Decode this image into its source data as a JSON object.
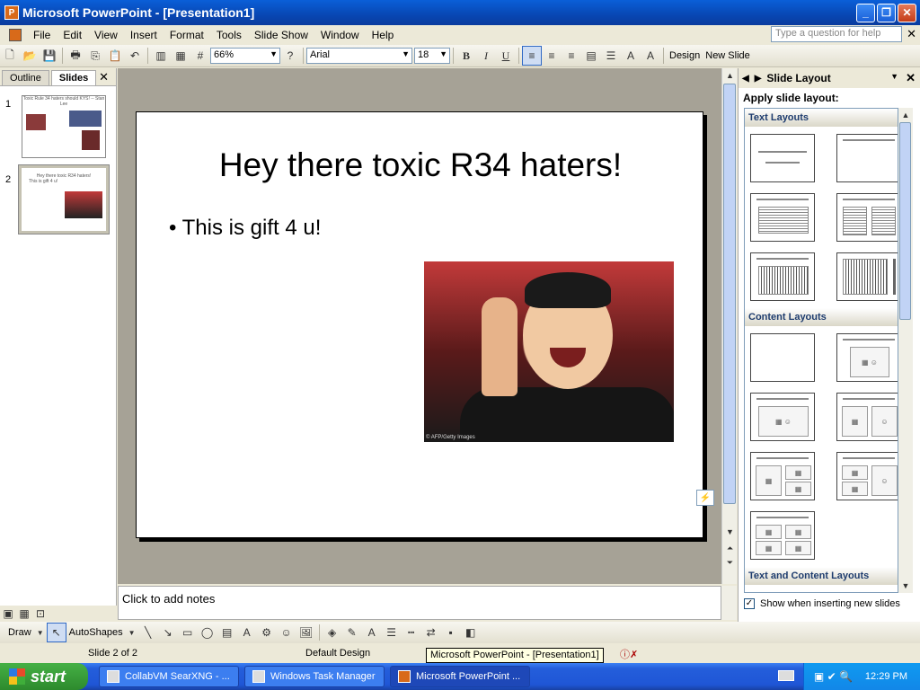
{
  "window": {
    "title": "Microsoft PowerPoint - [Presentation1]",
    "min": "_",
    "max": "❐",
    "close": "✕"
  },
  "menu": {
    "items": [
      "File",
      "Edit",
      "View",
      "Insert",
      "Format",
      "Tools",
      "Slide Show",
      "Window",
      "Help"
    ],
    "help_placeholder": "Type a question for help",
    "close": "✕"
  },
  "toolbar": {
    "zoom": "66%",
    "font": "Arial",
    "size": "18",
    "bold": "B",
    "italic": "I",
    "underline": "U",
    "design": "Design",
    "new_slide": "New Slide"
  },
  "left_pane": {
    "tab_outline": "Outline",
    "tab_slides": "Slides",
    "close": "✕",
    "thumbs": [
      {
        "num": "1",
        "title": "Toxic Rule 34 haters should KYS! -- Stan Lee"
      },
      {
        "num": "2",
        "title": "Hey there toxic R34 haters!",
        "body": "This is gift 4 u!"
      }
    ]
  },
  "slide": {
    "title": "Hey there toxic R34 haters!",
    "bullet": "This is gift 4 u!",
    "credit": "© AFP/Getty Images",
    "smart_tag": "⚡"
  },
  "notes": {
    "placeholder": "Click to add notes"
  },
  "task_pane": {
    "title": "Slide Layout",
    "subtitle": "Apply slide layout:",
    "section_text": "Text Layouts",
    "section_content": "Content Layouts",
    "section_text_content": "Text and Content Layouts",
    "show_check": "Show when inserting new slides"
  },
  "drawbar": {
    "draw": "Draw",
    "autoshapes": "AutoShapes"
  },
  "status": {
    "slide": "Slide 2 of 2",
    "design": "Default Design",
    "tooltip": "Microsoft PowerPoint - [Presentation1]"
  },
  "taskbar": {
    "start": "start",
    "tasks": [
      "CollabVM SearXNG - ...",
      "Windows Task Manager",
      "Microsoft PowerPoint ..."
    ],
    "clock": "12:29 PM"
  }
}
